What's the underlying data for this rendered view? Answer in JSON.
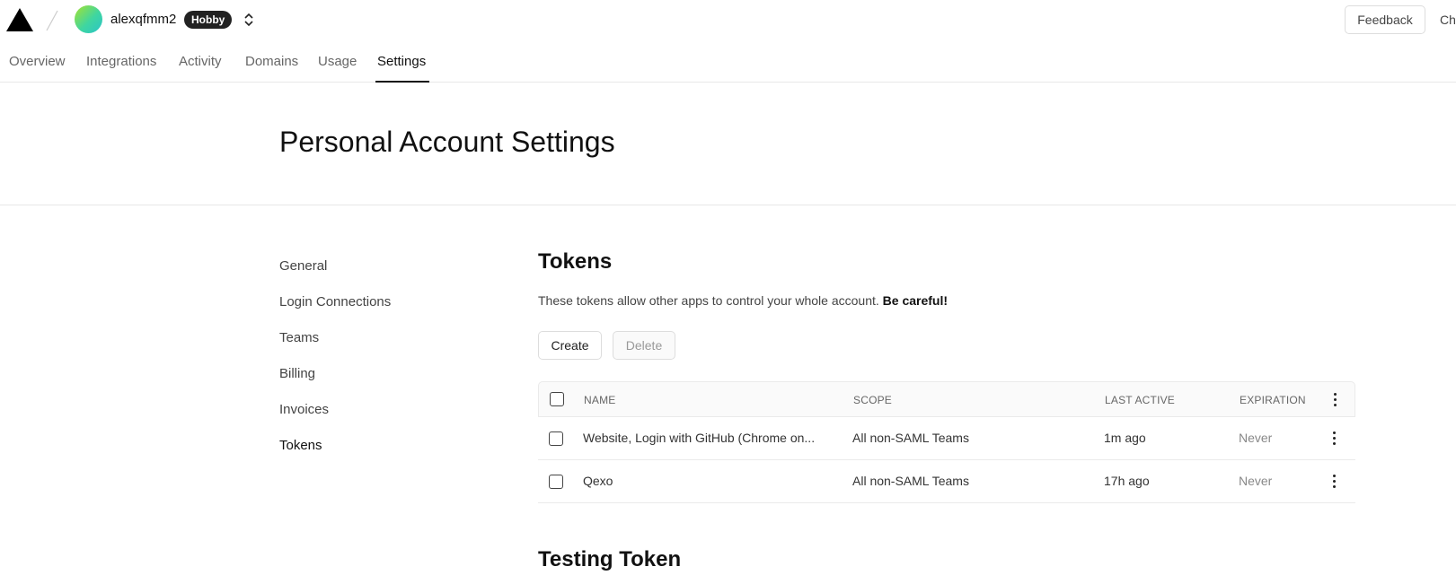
{
  "header": {
    "account_name": "alexqfmm2",
    "plan_badge": "Hobby",
    "feedback_label": "Feedback",
    "clipped_text": "Ch"
  },
  "tabs": [
    {
      "label": "Overview"
    },
    {
      "label": "Integrations"
    },
    {
      "label": "Activity"
    },
    {
      "label": "Domains"
    },
    {
      "label": "Usage"
    },
    {
      "label": "Settings",
      "active": true
    }
  ],
  "page": {
    "title": "Personal Account Settings"
  },
  "sidebar": {
    "items": [
      {
        "label": "General"
      },
      {
        "label": "Login Connections"
      },
      {
        "label": "Teams"
      },
      {
        "label": "Billing"
      },
      {
        "label": "Invoices"
      },
      {
        "label": "Tokens",
        "active": true
      }
    ]
  },
  "tokens": {
    "title": "Tokens",
    "description": "These tokens allow other apps to control your whole account.",
    "warning": "Be careful!",
    "create_label": "Create",
    "delete_label": "Delete",
    "columns": {
      "name": "NAME",
      "scope": "SCOPE",
      "last_active": "LAST ACTIVE",
      "expiration": "EXPIRATION"
    },
    "rows": [
      {
        "name": "Website, Login with GitHub (Chrome on...",
        "scope": "All non-SAML Teams",
        "last_active": "1m ago",
        "expiration": "Never"
      },
      {
        "name": "Qexo",
        "scope": "All non-SAML Teams",
        "last_active": "17h ago",
        "expiration": "Never"
      }
    ]
  },
  "testing_token": {
    "title": "Testing Token"
  },
  "icons": {
    "logo": "triangle-logo-icon",
    "switcher": "chevron-up-down-icon",
    "row_menu": "more-vertical-icon"
  }
}
